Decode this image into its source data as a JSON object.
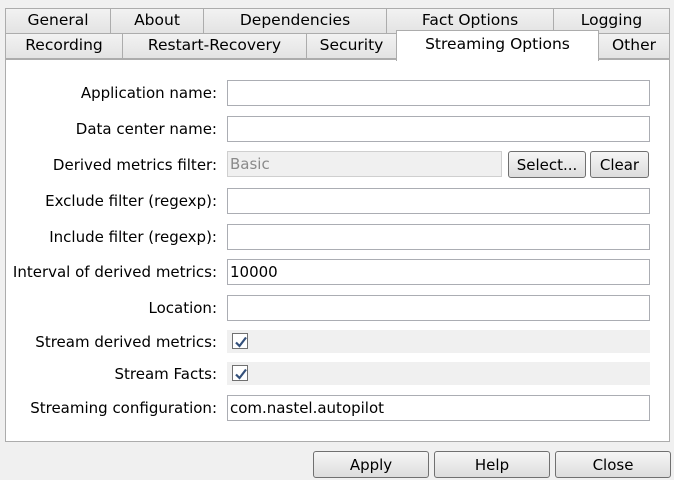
{
  "tabs": {
    "row1": [
      "General",
      "About",
      "Dependencies",
      "Fact Options",
      "Logging"
    ],
    "row2": [
      "Recording",
      "Restart-Recovery",
      "Security",
      "Streaming Options",
      "Other"
    ],
    "active": "Streaming Options"
  },
  "form": {
    "application_name": {
      "label": "Application name:",
      "value": ""
    },
    "data_center_name": {
      "label": "Data center name:",
      "value": ""
    },
    "derived_metrics_filter": {
      "label": "Derived metrics filter:",
      "value": "Basic",
      "select_label": "Select...",
      "clear_label": "Clear"
    },
    "exclude_filter": {
      "label": "Exclude filter (regexp):",
      "value": ""
    },
    "include_filter": {
      "label": "Include filter (regexp):",
      "value": ""
    },
    "interval_derived_metrics": {
      "label": "Interval of derived metrics:",
      "value": "10000"
    },
    "location": {
      "label": "Location:",
      "value": ""
    },
    "stream_derived_metrics": {
      "label": "Stream derived metrics:",
      "checked": true
    },
    "stream_facts": {
      "label": "Stream Facts:",
      "checked": true
    },
    "streaming_configuration": {
      "label": "Streaming configuration:",
      "value": "com.nastel.autopilot"
    }
  },
  "footer": {
    "apply_label": "Apply",
    "help_label": "Help",
    "close_label": "Close"
  },
  "colors": {
    "check_mark": "#34507a",
    "panel_bg": "#ffffff",
    "window_bg": "#f0f0f0"
  }
}
